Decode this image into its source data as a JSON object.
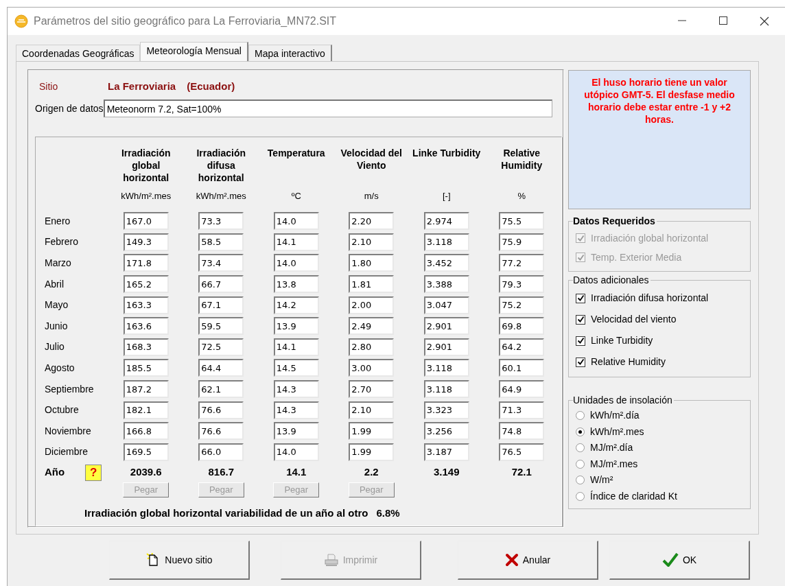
{
  "window": {
    "title": "Parámetros del sitio geográfico para La Ferroviaria_MN72.SIT"
  },
  "tabs": [
    {
      "label": "Coordenadas Geográficas",
      "selected": false
    },
    {
      "label": "Meteorología Mensual",
      "selected": true
    },
    {
      "label": "Mapa interactivo",
      "selected": false
    }
  ],
  "site": {
    "label": "Sitio",
    "name": "La Ferroviaria",
    "country": "(Ecuador)"
  },
  "data_source": {
    "label": "Origen de datos",
    "value": "Meteonorm 7.2, Sat=100%"
  },
  "columns": [
    {
      "title": "Irradiación global horizontal",
      "unit": "kWh/m².mes",
      "total": "2039.6",
      "paste_button": {
        "label": "Pegar",
        "disabled": true
      }
    },
    {
      "title": "Irradiación difusa horizontal",
      "unit": "kWh/m².mes",
      "total": "816.7",
      "paste_button": {
        "label": "Pegar",
        "disabled": true
      }
    },
    {
      "title": "Temperatura",
      "unit": "ºC",
      "total": "14.1",
      "paste_button": {
        "label": "Pegar",
        "disabled": true
      }
    },
    {
      "title": "Velocidad del Viento",
      "unit": "m/s",
      "total": "2.2",
      "paste_button": {
        "label": "Pegar",
        "disabled": true
      }
    },
    {
      "title": "Linke Turbidity",
      "unit": "[-]",
      "total": "3.149"
    },
    {
      "title": "Relative Humidity",
      "unit": "%",
      "total": "72.1"
    }
  ],
  "months": [
    {
      "name": "Enero",
      "values": [
        "167.0",
        "73.3",
        "14.0",
        "2.20",
        "2.974",
        "75.5"
      ]
    },
    {
      "name": "Febrero",
      "values": [
        "149.3",
        "58.5",
        "14.1",
        "2.10",
        "3.118",
        "75.9"
      ]
    },
    {
      "name": "Marzo",
      "values": [
        "171.8",
        "73.4",
        "14.0",
        "1.80",
        "3.452",
        "77.2"
      ]
    },
    {
      "name": "Abril",
      "values": [
        "165.2",
        "66.7",
        "13.8",
        "1.81",
        "3.388",
        "79.3"
      ]
    },
    {
      "name": "Mayo",
      "values": [
        "163.3",
        "67.1",
        "14.2",
        "2.00",
        "3.047",
        "75.2"
      ]
    },
    {
      "name": "Junio",
      "values": [
        "163.6",
        "59.5",
        "13.9",
        "2.49",
        "2.901",
        "69.8"
      ]
    },
    {
      "name": "Julio",
      "values": [
        "168.3",
        "72.5",
        "14.1",
        "2.80",
        "2.901",
        "64.2"
      ]
    },
    {
      "name": "Agosto",
      "values": [
        "185.5",
        "64.4",
        "14.5",
        "3.00",
        "3.118",
        "60.1"
      ]
    },
    {
      "name": "Septiembre",
      "values": [
        "187.2",
        "62.1",
        "14.3",
        "2.70",
        "3.118",
        "64.9"
      ]
    },
    {
      "name": "Octubre",
      "values": [
        "182.1",
        "76.6",
        "14.3",
        "2.10",
        "3.323",
        "71.3"
      ]
    },
    {
      "name": "Noviembre",
      "values": [
        "166.8",
        "76.6",
        "13.9",
        "1.99",
        "3.256",
        "74.8"
      ]
    },
    {
      "name": "Diciembre",
      "values": [
        "169.5",
        "66.0",
        "14.0",
        "1.99",
        "3.187",
        "76.5"
      ]
    }
  ],
  "year_label": "Año",
  "help_button": "?",
  "variability": {
    "label": "Irradiación global horizontal variabilidad de un año al otro",
    "value": "6.8%"
  },
  "warning": "El huso horario tiene un valor utópico GMT-5. El desfase medio horario debe estar entre -1 y +2 horas.",
  "required_data": {
    "title": "Datos Requeridos",
    "items": [
      {
        "label": "Irradiación global horizontal",
        "checked": true,
        "disabled": true
      },
      {
        "label": "Temp. Exterior Media",
        "checked": true,
        "disabled": true
      }
    ]
  },
  "additional_data": {
    "title": "Datos adicionales",
    "items": [
      {
        "label": "Irradiación difusa horizontal",
        "checked": true,
        "disabled": false
      },
      {
        "label": "Velocidad del viento",
        "checked": true,
        "disabled": false
      },
      {
        "label": "Linke Turbidity",
        "checked": true,
        "disabled": false
      },
      {
        "label": "Relative Humidity",
        "checked": true,
        "disabled": false
      }
    ]
  },
  "insolation_units": {
    "title": "Unidades de insolación",
    "options": [
      {
        "label": "kWh/m².día",
        "selected": false
      },
      {
        "label": "kWh/m².mes",
        "selected": true
      },
      {
        "label": "MJ/m².día",
        "selected": false
      },
      {
        "label": "MJ/m².mes",
        "selected": false
      },
      {
        "label": "W/m²",
        "selected": false
      },
      {
        "label": "Índice de claridad Kt",
        "selected": false
      }
    ]
  },
  "buttons": [
    {
      "label": "Nuevo sitio",
      "kind": "new",
      "disabled": false
    },
    {
      "label": "Imprimir",
      "kind": "print",
      "disabled": true
    },
    {
      "label": "Anular",
      "kind": "cancel",
      "disabled": false
    },
    {
      "label": "OK",
      "kind": "ok",
      "disabled": false
    }
  ]
}
